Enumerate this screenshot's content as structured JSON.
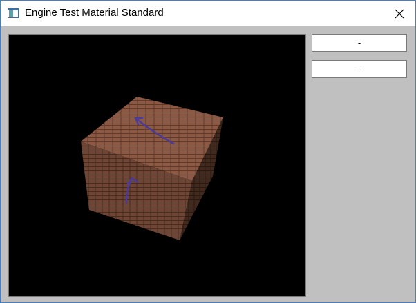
{
  "window": {
    "title": "Engine Test Material Standard"
  },
  "icons": {
    "app": "application-window-icon",
    "close": "close-icon",
    "scene": "brick-cube-3d"
  },
  "panel": {
    "buttons": [
      {
        "label": "-"
      },
      {
        "label": "-"
      }
    ]
  },
  "colors": {
    "viewport_background": "#000000",
    "panel_background": "#c0c0c0",
    "brick": "#8a5a44",
    "arrow": "#4b3a9a"
  }
}
